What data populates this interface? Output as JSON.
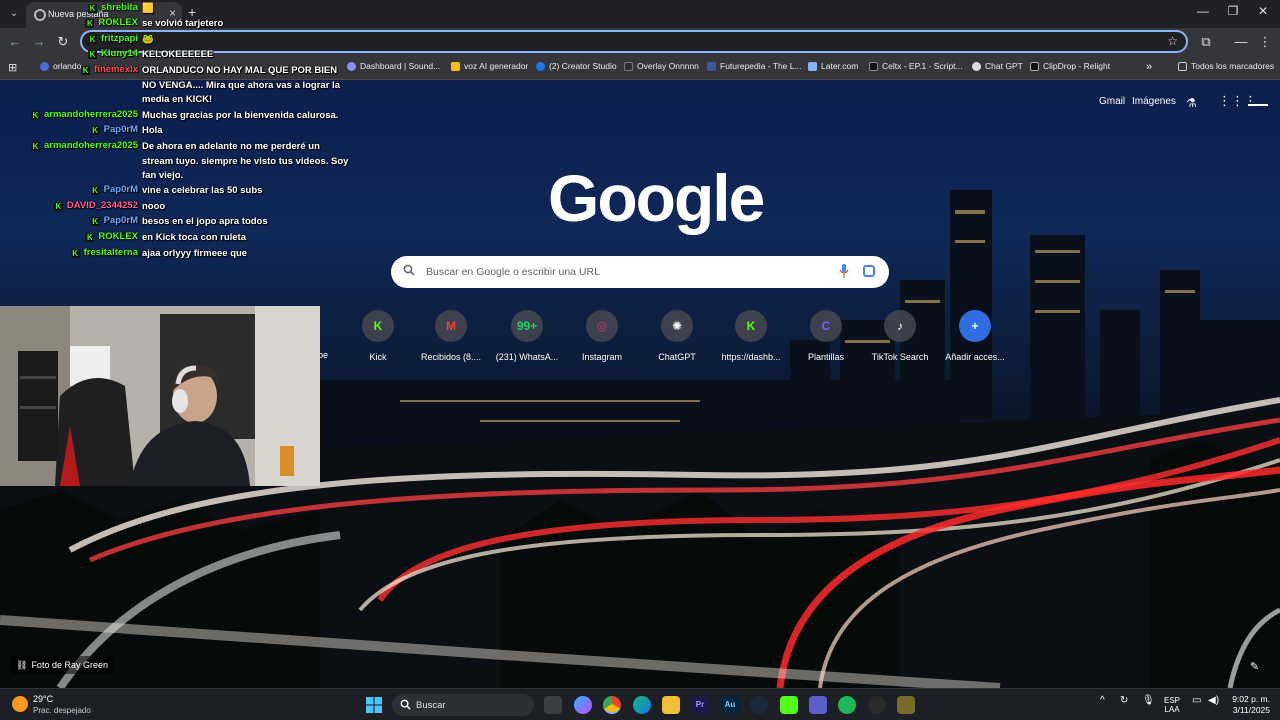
{
  "browser": {
    "tab_title": "Nueva pestaña",
    "bookmarks": [
      "orlando",
      "Dashboard | Sound...",
      "voz AI generador",
      "(2) Creator Studio",
      "Overlay Onnnnn",
      "Futurepedia - The L...",
      "Later.com",
      "Celtx - EP.1 - Script...",
      "Chat GPT",
      "ClipDrop - Relight"
    ],
    "all_bookmarks": "Todos los marcadores"
  },
  "google": {
    "gmail": "Gmail",
    "images": "Imágenes",
    "logo": "Google",
    "search_placeholder": "Buscar en Google o escribir una URL",
    "shortcuts": [
      {
        "label": "Kick",
        "glyph": "K",
        "color": "#53fc18"
      },
      {
        "label": "Recibidos (8....",
        "glyph": "M",
        "color": "#ea4335"
      },
      {
        "label": "(231) WhatsA...",
        "glyph": "99+",
        "color": "#25d366"
      },
      {
        "label": "Instagram",
        "glyph": "◎",
        "color": "#e1306c"
      },
      {
        "label": "ChatGPT",
        "glyph": "✺",
        "color": "#ffffff"
      },
      {
        "label": "https://dashb...",
        "glyph": "K",
        "color": "#53fc18"
      },
      {
        "label": "Plantillas",
        "glyph": "C",
        "color": "#7d5cff"
      },
      {
        "label": "TikTok Search",
        "glyph": "♪",
        "color": "#ffffff"
      },
      {
        "label": "Añadir acces...",
        "glyph": "+",
        "color": "#ffffff"
      }
    ],
    "partial_shortcut_label": "ube",
    "photo_credit": "Foto de Ray Green"
  },
  "chat": {
    "messages": [
      {
        "user": "shrebita",
        "color": "#53fc18",
        "text": "🟨"
      },
      {
        "user": "ROKLEX",
        "color": "#53fc18",
        "text": "se volvió tarjetero"
      },
      {
        "user": "fritzpapi",
        "color": "#53fc18",
        "text": "🐸"
      },
      {
        "user": "Kluny14",
        "color": "#53fc18",
        "text": "KELOKEEEEEE"
      },
      {
        "user": "finemexix",
        "color": "#ff4d4d",
        "text": "ORLANDUCO NO HAY MAL QUE POR BIEN NO VENGA.... Mira que ahora vas a lograr la media en KICK!"
      },
      {
        "user": "armandoherrera2025",
        "color": "#53fc18",
        "text": "Muchas gracias por la bienvenida calurosa."
      },
      {
        "user": "Pap0rM",
        "color": "#6fa8ff",
        "text": "Hola"
      },
      {
        "user": "armandoherrera2025",
        "color": "#53fc18",
        "text": "De ahora en adelante no me perderé un stream tuyo. siempre he visto tus videos. Soy fan viejo."
      },
      {
        "user": "Pap0rM",
        "color": "#6fa8ff",
        "text": "vine a celebrar las 50 subs"
      },
      {
        "user": "DAVID_2344252",
        "color": "#ff5c8a",
        "text": "nooo"
      },
      {
        "user": "Pap0rM",
        "color": "#6fa8ff",
        "text": "besos en el jopo apra todos"
      },
      {
        "user": "ROKLEX",
        "color": "#53fc18",
        "text": "en Kick toca con ruleta"
      },
      {
        "user": "fresitalterna",
        "color": "#53fc18",
        "text": "ajaa orlyyy firmeee que"
      }
    ]
  },
  "taskbar": {
    "temperature": "29°C",
    "weather": "Prac. despejado",
    "search": "Buscar",
    "lang_top": "ESP",
    "lang_bottom": "LAA",
    "time": "9:02 p. m.",
    "date": "3/11/2025"
  }
}
